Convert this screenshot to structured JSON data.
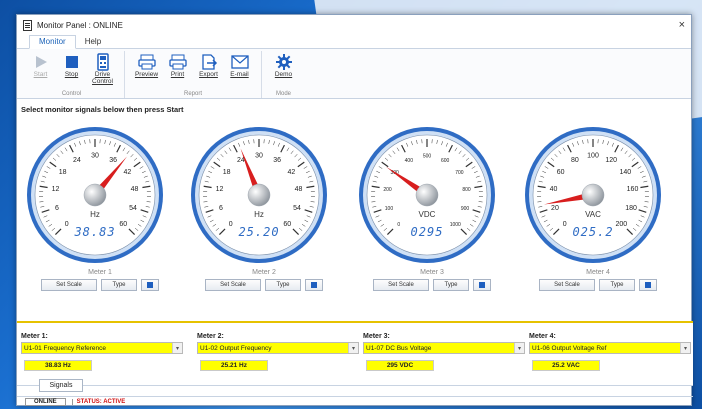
{
  "window": {
    "title": "Monitor Panel : ONLINE",
    "close_glyph": "×"
  },
  "menu": {
    "tabs": [
      "Monitor",
      "Help"
    ]
  },
  "ribbon": {
    "groups": [
      {
        "name": "Control",
        "buttons": [
          {
            "label": "Start",
            "icon": "play-icon",
            "enabled": false
          },
          {
            "label": "Stop",
            "icon": "stop-icon",
            "enabled": true
          },
          {
            "label": "Drive\nControl",
            "icon": "drive-control-icon",
            "enabled": true
          }
        ]
      },
      {
        "name": "Report",
        "buttons": [
          {
            "label": "Preview",
            "icon": "preview-icon",
            "enabled": true
          },
          {
            "label": "Print",
            "icon": "printer-icon",
            "enabled": true
          },
          {
            "label": "Export",
            "icon": "export-icon",
            "enabled": true
          },
          {
            "label": "E-mail",
            "icon": "email-icon",
            "enabled": true
          }
        ]
      },
      {
        "name": "Mode",
        "buttons": [
          {
            "label": "Demo",
            "icon": "gear-icon",
            "enabled": true
          }
        ]
      }
    ]
  },
  "prompt": "Select monitor signals below then press Start",
  "meters": [
    {
      "name": "Meter 1",
      "unit": "Hz",
      "readout": "38.83",
      "value": 38.83,
      "min": 0,
      "max": 60,
      "ticks": [
        "0",
        "6",
        "12",
        "18",
        "24",
        "30",
        "36",
        "42",
        "48",
        "54",
        "60"
      ]
    },
    {
      "name": "Meter 2",
      "unit": "Hz",
      "readout": "25.20",
      "value": 25.2,
      "min": 0,
      "max": 60,
      "ticks": [
        "0",
        "6",
        "12",
        "18",
        "24",
        "30",
        "36",
        "42",
        "48",
        "54",
        "60"
      ]
    },
    {
      "name": "Meter 3",
      "unit": "VDC",
      "readout": "0295",
      "value": 295,
      "min": 0,
      "max": 1000,
      "ticks": [
        "0",
        "100",
        "200",
        "300",
        "400",
        "500",
        "600",
        "700",
        "800",
        "900",
        "1000"
      ]
    },
    {
      "name": "Meter 4",
      "unit": "VAC",
      "readout": "025.2",
      "value": 25.2,
      "min": 0,
      "max": 200,
      "ticks": [
        "0",
        "20",
        "40",
        "60",
        "80",
        "100",
        "120",
        "140",
        "160",
        "180",
        "200"
      ]
    }
  ],
  "meter_buttons": {
    "set_scale": "Set Scale",
    "type": "Type"
  },
  "slots": [
    {
      "header": "Meter 1:",
      "signal": "U1-01 Frequency Reference",
      "value": "38.83 Hz"
    },
    {
      "header": "Meter 2:",
      "signal": "U1-02 Output Frequency",
      "value": "25.21 Hz"
    },
    {
      "header": "Meter 3:",
      "signal": "U1-07 DC Bus Voltage",
      "value": "295 VDC"
    },
    {
      "header": "Meter 4:",
      "signal": "U1-06 Output Voltage Ref",
      "value": "25.2 VAC"
    }
  ],
  "signals_tab": "Signals",
  "status": {
    "online": "ONLINE",
    "active": "STATUS: ACTIVE"
  },
  "colors": {
    "accent": "#1c63b8",
    "needle": "#d81e1e",
    "highlight": "#ffff00",
    "status_red": "#d01010"
  }
}
